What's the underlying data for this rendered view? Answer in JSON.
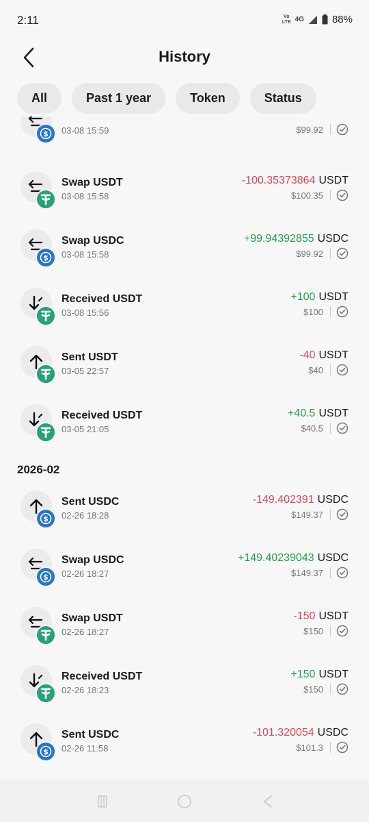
{
  "status": {
    "time": "2:11",
    "volte_line1": "Vo",
    "volte_line2": "LTE",
    "network": "4G",
    "battery": "88%"
  },
  "header": {
    "title": "History"
  },
  "filters": [
    "All",
    "Past 1 year",
    "Token",
    "Status"
  ],
  "first_partial": {
    "date": "03-08 15:59",
    "fiat": "$99.92",
    "token_icon": "usdc-icon"
  },
  "months": {
    "m2": "2026-02"
  },
  "transactions": [
    {
      "type": "swap",
      "title": "Swap USDT",
      "date": "03-08 15:58",
      "amount": "-100.35373864",
      "token": "USDT",
      "fiat": "$100.35",
      "token_icon": "usdt-icon"
    },
    {
      "type": "swap",
      "title": "Swap USDC",
      "date": "03-08 15:58",
      "amount": "+99.94392855",
      "token": "USDC",
      "fiat": "$99.92",
      "token_icon": "usdc-icon"
    },
    {
      "type": "received",
      "title": "Received USDT",
      "date": "03-08 15:56",
      "amount": "+100",
      "token": "USDT",
      "fiat": "$100",
      "token_icon": "usdt-icon"
    },
    {
      "type": "sent",
      "title": "Sent USDT",
      "date": "03-05 22:57",
      "amount": "-40",
      "token": "USDT",
      "fiat": "$40",
      "token_icon": "usdt-icon"
    },
    {
      "type": "received",
      "title": "Received USDT",
      "date": "03-05 21:05",
      "amount": "+40.5",
      "token": "USDT",
      "fiat": "$40.5",
      "token_icon": "usdt-icon"
    },
    {
      "type": "sent",
      "title": "Sent USDC",
      "date": "02-26 18:28",
      "amount": "-149.402391",
      "token": "USDC",
      "fiat": "$149.37",
      "token_icon": "usdc-icon"
    },
    {
      "type": "swap",
      "title": "Swap USDC",
      "date": "02-26 18:27",
      "amount": "+149.40239043",
      "token": "USDC",
      "fiat": "$149.37",
      "token_icon": "usdc-icon"
    },
    {
      "type": "swap",
      "title": "Swap USDT",
      "date": "02-26 18:27",
      "amount": "-150",
      "token": "USDT",
      "fiat": "$150",
      "token_icon": "usdt-icon"
    },
    {
      "type": "received",
      "title": "Received USDT",
      "date": "02-26 18:23",
      "amount": "+150",
      "token": "USDT",
      "fiat": "$150",
      "token_icon": "usdt-icon"
    },
    {
      "type": "sent",
      "title": "Sent USDC",
      "date": "02-26 11:58",
      "amount": "-101.320054",
      "token": "USDC",
      "fiat": "$101.3",
      "token_icon": "usdc-icon"
    }
  ],
  "colors": {
    "negative": "#e04353",
    "positive": "#24a04a",
    "usdt": "#26a17b",
    "usdc": "#2775ca"
  }
}
